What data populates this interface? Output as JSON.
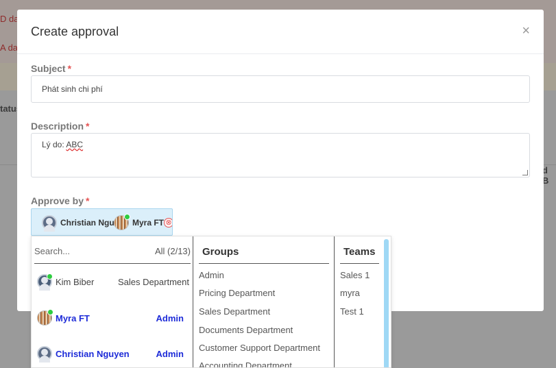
{
  "background": {
    "alert_text_1": "D dat",
    "alert_text_2": "A dat",
    "status_label": "tatus",
    "column_label": "d B"
  },
  "modal": {
    "title": "Create approval",
    "close_icon": "×",
    "subject": {
      "label": "Subject",
      "required": "*",
      "value": "Phát sinh chi phí"
    },
    "description": {
      "label": "Description",
      "required": "*",
      "value_prefix": "Lý do: ",
      "value_underlined": "ABC"
    },
    "approve_by": {
      "label": "Approve by",
      "required": "*",
      "selected": [
        {
          "name": "Christian Ngu",
          "avatar": "person-silhouette-icon"
        },
        {
          "name": "Myra FT",
          "avatar": "striped-avatar-icon",
          "online": true
        }
      ],
      "remove_icon": "⊗"
    }
  },
  "dropdown": {
    "search_placeholder": "Search...",
    "count": "All (2/13)",
    "users": [
      {
        "name": "Kim Biber",
        "dept": "Sales Department",
        "selected": false,
        "avatar": "person-silhouette-icon",
        "online": true
      },
      {
        "name": "Myra FT",
        "dept": "Admin",
        "selected": true,
        "avatar": "striped-avatar-icon",
        "online": true
      },
      {
        "name": "Christian Nguyen",
        "dept": "Admin",
        "selected": true,
        "avatar": "person-silhouette-icon",
        "online": false
      }
    ],
    "groups": {
      "title": "Groups",
      "items": [
        "Admin",
        "Pricing Department",
        "Sales Department",
        "Documents Department",
        "Customer Support Department",
        "Accounting Department"
      ]
    },
    "teams": {
      "title": "Teams",
      "items": [
        "Sales 1",
        "myra",
        "Test 1"
      ]
    }
  },
  "colors": {
    "selected_user": "#1d2bd8",
    "required": "#e55353",
    "chip_bg": "#dbeffa",
    "scrollbar": "#9fd8f5"
  }
}
